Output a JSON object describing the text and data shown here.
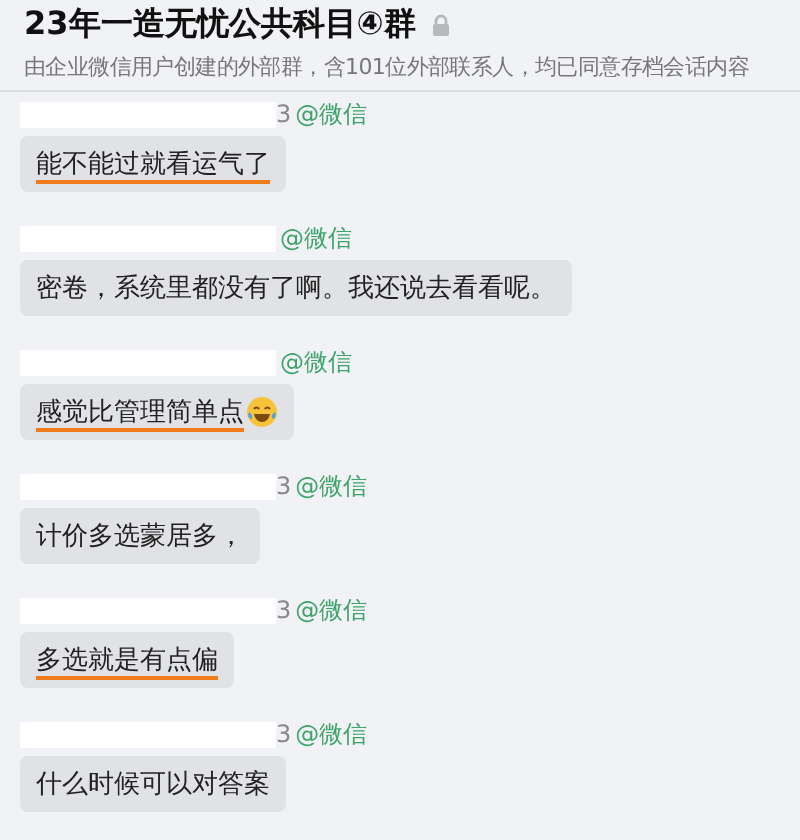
{
  "header": {
    "title": "23年一造无忧公共科目④群",
    "subtitle": "由企业微信用户创建的外部群，含101位外部联系人，均已同意存档会话内容"
  },
  "messages": [
    {
      "name_tail": "3",
      "source": "@微信",
      "text": "能不能过就看运气了",
      "underlined": true,
      "emoji": false
    },
    {
      "source": "@微信",
      "text": "密卷，系统里都没有了啊。我还说去看看呢。",
      "underlined": false,
      "emoji": false
    },
    {
      "source": "@微信",
      "text": "感觉比管理简单点",
      "underlined": true,
      "emoji": true
    },
    {
      "name_tail": "3",
      "source": "@微信",
      "text": "计价多选蒙居多，",
      "underlined": false,
      "emoji": false
    },
    {
      "name_tail": "3",
      "source": "@微信",
      "text": "多选就是有点偏",
      "underlined": true,
      "emoji": false
    },
    {
      "name_tail": "3",
      "source": "@微信",
      "text": "什么时候可以对答案",
      "underlined": false,
      "emoji": false
    }
  ]
}
